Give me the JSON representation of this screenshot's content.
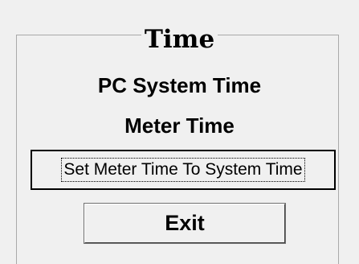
{
  "dialog": {
    "title": "Time",
    "pc_system_time_label": "PC System Time",
    "meter_time_label": "Meter Time",
    "set_time_button_label": "Set Meter Time To System Time",
    "exit_button_label": "Exit"
  }
}
